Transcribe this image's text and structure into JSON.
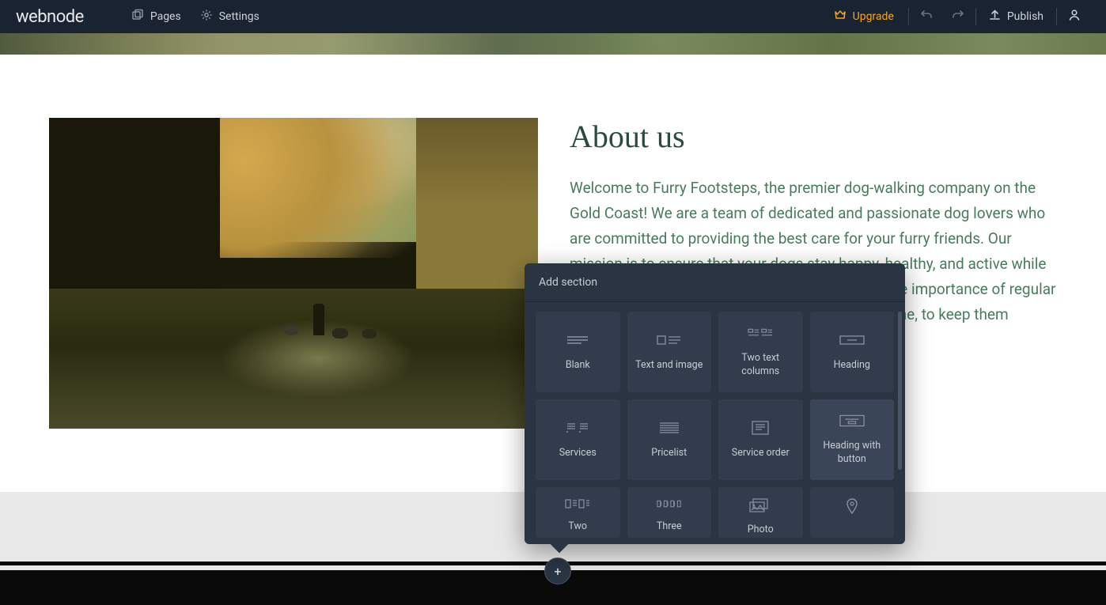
{
  "brand": "webnode",
  "topbar": {
    "pages": "Pages",
    "settings": "Settings",
    "upgrade": "Upgrade",
    "publish": "Publish"
  },
  "content": {
    "heading": "About us",
    "body": "Welcome to Furry Footsteps, the premier dog-walking company on the Gold Coast! We are a team of dedicated and passionate dog lovers who are committed to providing the best care for your furry friends. Our mission is to ensure that your dogs stay happy, healthy, and active while you're away. At Furry Footsteps, we understand the importance of regular exercise for dogs and offer daily walks, rain or shine, to keep them mentally and physically engaged."
  },
  "popover": {
    "title": "Add section",
    "items": [
      {
        "id": "blank",
        "label": "Blank"
      },
      {
        "id": "text-image",
        "label": "Text and image"
      },
      {
        "id": "two-text-columns",
        "label": "Two text columns"
      },
      {
        "id": "heading",
        "label": "Heading"
      },
      {
        "id": "services",
        "label": "Services"
      },
      {
        "id": "pricelist",
        "label": "Pricelist"
      },
      {
        "id": "service-order",
        "label": "Service order"
      },
      {
        "id": "heading-button",
        "label": "Heading with button"
      },
      {
        "id": "two",
        "label": "Two"
      },
      {
        "id": "three",
        "label": "Three"
      },
      {
        "id": "photo",
        "label": "Photo"
      },
      {
        "id": "map",
        "label": ""
      }
    ]
  },
  "colors": {
    "topbar_bg": "#1a2332",
    "accent": "#f5a623",
    "heading": "#2c4a3e",
    "body_text": "#4a7a5e",
    "popover_bg": "#2a3442"
  }
}
